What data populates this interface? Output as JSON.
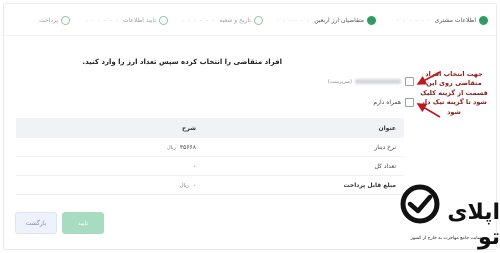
{
  "stepper": {
    "steps": [
      {
        "label": "اطلاعات مشتری",
        "state": "done"
      },
      {
        "label": "متقاضیان ارز اربعین",
        "state": "done"
      },
      {
        "label": "تاریخ و شعبه",
        "state": "pending"
      },
      {
        "label": "تایید اطلاعات",
        "state": "pending"
      },
      {
        "label": "پرداخت",
        "state": "pending"
      }
    ]
  },
  "question": "افراد متقاضی را انتخاب کرده سپس تعداد ارز را وارد کنید.",
  "options": {
    "self_tag": "(سرپرست)",
    "companion_label": "همراه دارم"
  },
  "table": {
    "headers": {
      "title": "عنوان",
      "desc": "شرح"
    },
    "rows": [
      {
        "title": "نرخ دینار",
        "value": "۳۵۶۶۸",
        "unit": "ریال"
      },
      {
        "title": "تعداد کل",
        "value": "۰",
        "unit": ""
      },
      {
        "title": "مبلغ قابل پرداخت",
        "value": "۰",
        "unit": "ریال"
      }
    ]
  },
  "buttons": {
    "confirm": "تایید",
    "back": "بازگشت"
  },
  "annotation": "جهت انتخاب افراد متقاضی روی این قسمت از گزینه کلیک شود تا گزینه تیک دار شود",
  "watermark": {
    "brand": "اپلای تو",
    "tagline": "سایت جامع مهاجرت به خارج از کشور"
  },
  "colors": {
    "accent": "#2e9c5e",
    "annotation": "#8b1a1a",
    "arrow": "#c0161e"
  }
}
